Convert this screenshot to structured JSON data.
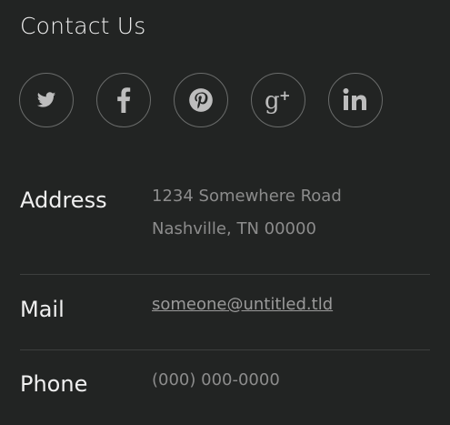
{
  "section": {
    "title": "Contact Us"
  },
  "social": [
    {
      "name": "twitter"
    },
    {
      "name": "facebook"
    },
    {
      "name": "pinterest"
    },
    {
      "name": "google-plus"
    },
    {
      "name": "linkedin"
    }
  ],
  "contact": {
    "address": {
      "label": "Address",
      "line1": "1234 Somewhere Road",
      "line2": "Nashville, TN 00000"
    },
    "mail": {
      "label": "Mail",
      "value": "someone@untitled.tld"
    },
    "phone": {
      "label": "Phone",
      "value": "(000) 000-0000"
    }
  },
  "colors": {
    "background": "#222423",
    "text_primary": "#f0f0f0",
    "text_muted": "#8c8c8c",
    "divider": "#3d3f3e"
  }
}
